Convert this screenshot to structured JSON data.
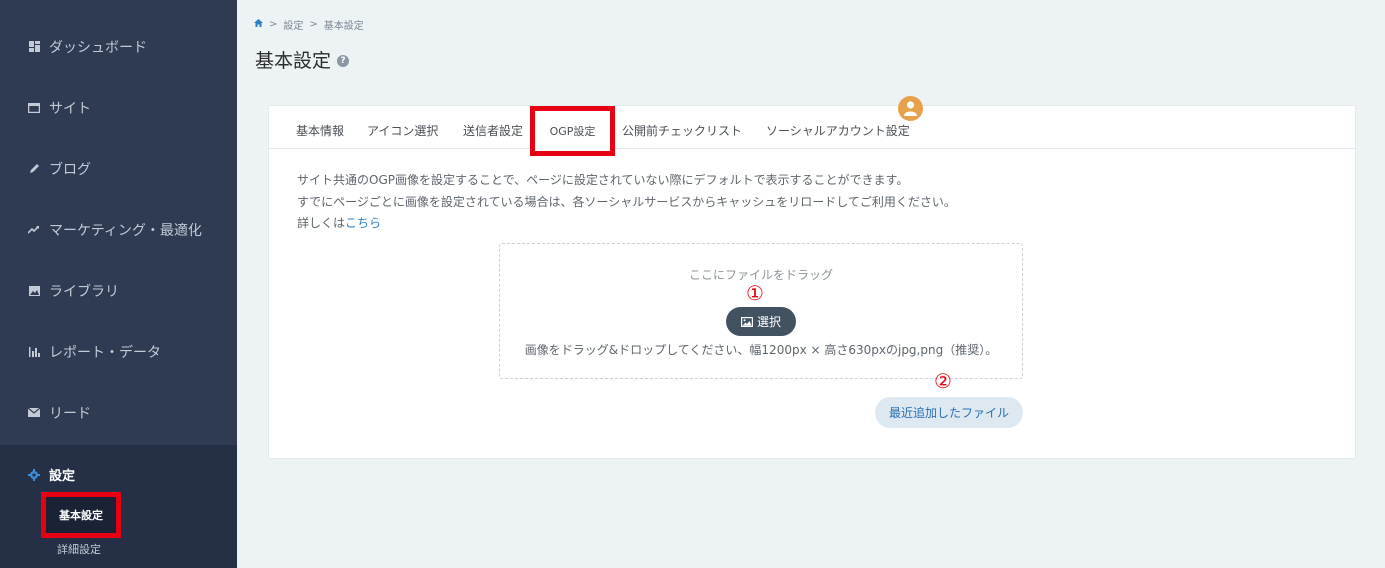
{
  "sidebar": {
    "items": [
      {
        "label": "ダッシュボード",
        "icon": "dashboard-icon"
      },
      {
        "label": "サイト",
        "icon": "site-icon"
      },
      {
        "label": "ブログ",
        "icon": "pencil-icon"
      },
      {
        "label": "マーケティング・最適化",
        "icon": "trend-icon"
      },
      {
        "label": "ライブラリ",
        "icon": "image-icon"
      },
      {
        "label": "レポート・データ",
        "icon": "bar-chart-icon"
      },
      {
        "label": "リード",
        "icon": "mail-icon"
      }
    ],
    "settings": {
      "label": "設定",
      "icon": "gear-icon",
      "sub_items": [
        {
          "label": "基本設定",
          "active": true
        },
        {
          "label": "詳細設定"
        }
      ]
    }
  },
  "breadcrumb": [
    "設定",
    "基本設定"
  ],
  "breadcrumb_separator": ">",
  "page_title": "基本設定",
  "tabs": [
    "基本情報",
    "アイコン選択",
    "送信者設定",
    "OGP設定",
    "公開前チェックリスト",
    "ソーシャルアカウント設定"
  ],
  "active_tab": "OGP設定",
  "description": {
    "line1": "サイト共通のOGP画像を設定することで、ページに設定されていない際にデフォルトで表示することができます。",
    "line2": "すでにページごとに画像を設定されている場合は、各ソーシャルサービスからキャッシュをリロードしてご利用ください。",
    "line3_prefix": "詳しくは",
    "line3_link": "こちら"
  },
  "dropzone": {
    "drag_text": "ここにファイルをドラッグ",
    "select_label": "選択",
    "hint": "画像をドラッグ&ドロップしてください、幅1200px × 高さ630pxのjpg,png（推奨）。"
  },
  "annotations": {
    "marker1": "①",
    "marker2": "②"
  },
  "recent_files_label": "最近追加したファイル",
  "colors": {
    "sidebar_bg": "#2e3b52",
    "highlight_red": "#e60012",
    "link": "#2b7fc6",
    "avatar": "#e6a14a"
  }
}
